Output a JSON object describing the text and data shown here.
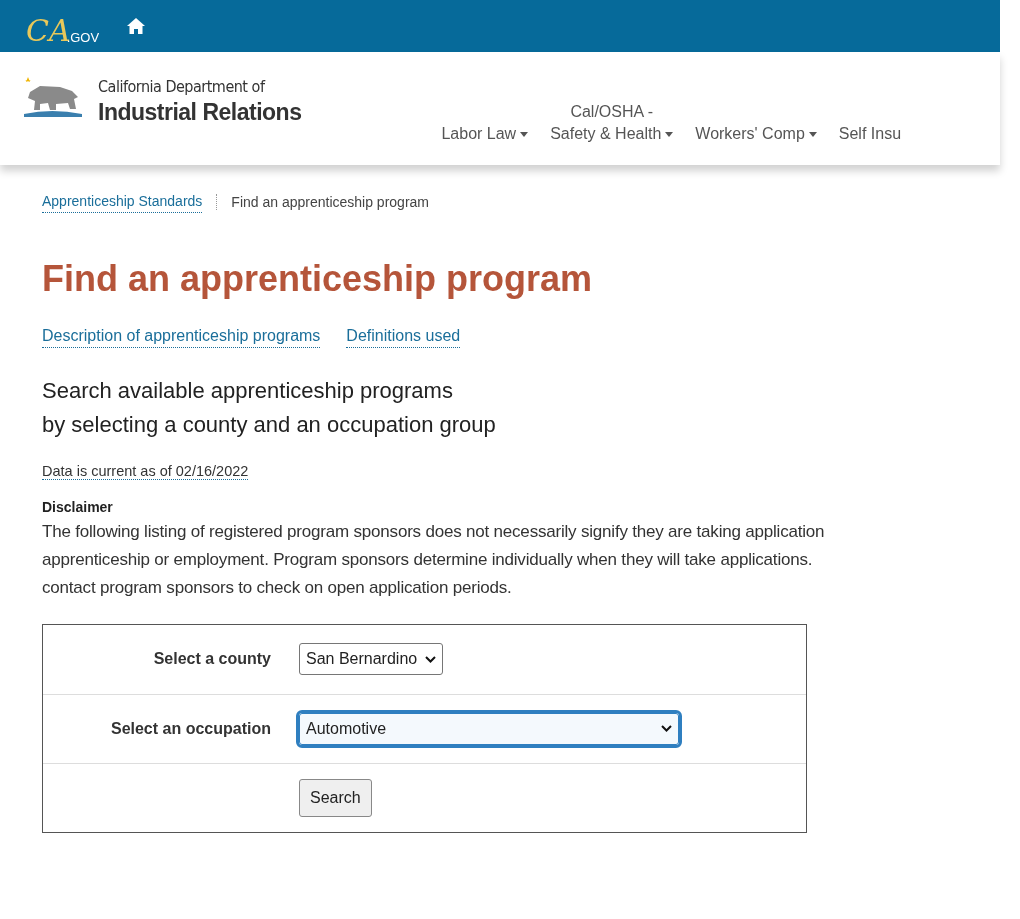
{
  "topbar": {
    "logo": {
      "script": "CA",
      "suffix": ".GOV"
    }
  },
  "header": {
    "org_line1": "California Department of",
    "org_line2": "Industrial Relations",
    "nav": [
      {
        "label": "Labor Law",
        "dropdown": true
      },
      {
        "label_top": "Cal/OSHA -",
        "label": "Safety & Health",
        "dropdown": true
      },
      {
        "label": "Workers' Comp",
        "dropdown": true
      },
      {
        "label": "Self Insu",
        "dropdown": false
      }
    ]
  },
  "breadcrumb": [
    {
      "label": "Apprenticeship Standards",
      "link": true
    },
    {
      "label": "Find an apprenticeship program",
      "link": false
    }
  ],
  "title": "Find an apprenticeship program",
  "links": [
    "Description of apprenticeship programs",
    "Definitions used"
  ],
  "subtitle_lines": [
    "Search available apprenticeship programs",
    "by selecting a county and an occupation group"
  ],
  "data_current": "Data is current as of 02/16/2022",
  "disclaimer": {
    "heading": "Disclaimer",
    "lines": [
      "The following listing of registered program sponsors does not necessarily signify they are taking application",
      "apprenticeship or employment. Program sponsors determine individually when they will take applications.",
      "contact program sponsors to check on open application periods."
    ]
  },
  "form": {
    "rows": [
      {
        "kind": "select",
        "label": "Select a county",
        "value": "San Bernardino",
        "focused": false
      },
      {
        "kind": "wide-select",
        "label": "Select an occupation",
        "value": "Automotive",
        "focused": true
      },
      {
        "kind": "button",
        "value": "Search"
      }
    ]
  }
}
